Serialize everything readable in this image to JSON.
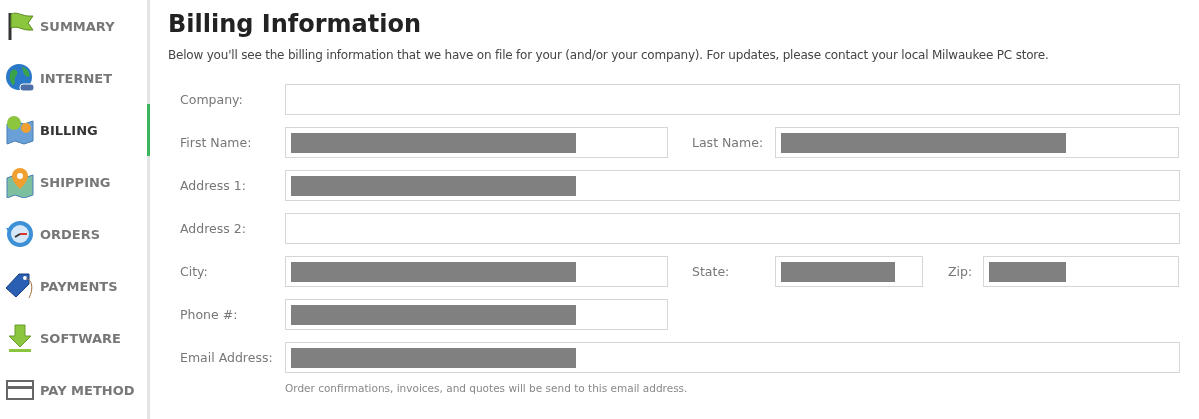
{
  "sidebar": {
    "items": [
      {
        "label": "SUMMARY",
        "selected": false
      },
      {
        "label": "INTERNET",
        "selected": false
      },
      {
        "label": "BILLING",
        "selected": true
      },
      {
        "label": "SHIPPING",
        "selected": false
      },
      {
        "label": "ORDERS",
        "selected": false
      },
      {
        "label": "PAYMENTS",
        "selected": false
      },
      {
        "label": "SOFTWARE",
        "selected": false
      },
      {
        "label": "PAY METHOD",
        "selected": false
      }
    ]
  },
  "title": "Billing Information",
  "description": "Below you'll see the billing information that we have on file for your (and/or your company). For updates, please contact your local Milwaukee PC store.",
  "form": {
    "rows": [
      {
        "fields": [
          {
            "label": "Company:",
            "kind": "full",
            "redacted": false
          }
        ]
      },
      {
        "fields": [
          {
            "label": "First Name:",
            "kind": "half",
            "redacted": true
          },
          {
            "label": "Last Name:",
            "kind": "rest",
            "redacted": true
          }
        ]
      },
      {
        "fields": [
          {
            "label": "Address 1:",
            "kind": "full",
            "redacted": true
          }
        ]
      },
      {
        "fields": [
          {
            "label": "Address 2:",
            "kind": "full",
            "redacted": false
          }
        ]
      },
      {
        "fields": [
          {
            "label": "City:",
            "kind": "half",
            "redacted": true
          },
          {
            "label": "State:",
            "kind": "state",
            "redacted": true
          },
          {
            "label": "Zip:",
            "kind": "zip",
            "redacted": true
          }
        ]
      },
      {
        "fields": [
          {
            "label": "Phone #:",
            "kind": "half",
            "redacted": true
          }
        ]
      },
      {
        "fields": [
          {
            "label": "Email Address:",
            "kind": "full",
            "redacted": true
          }
        ]
      }
    ],
    "note": "Order confirmations, invoices, and quotes will be send to this email address."
  }
}
